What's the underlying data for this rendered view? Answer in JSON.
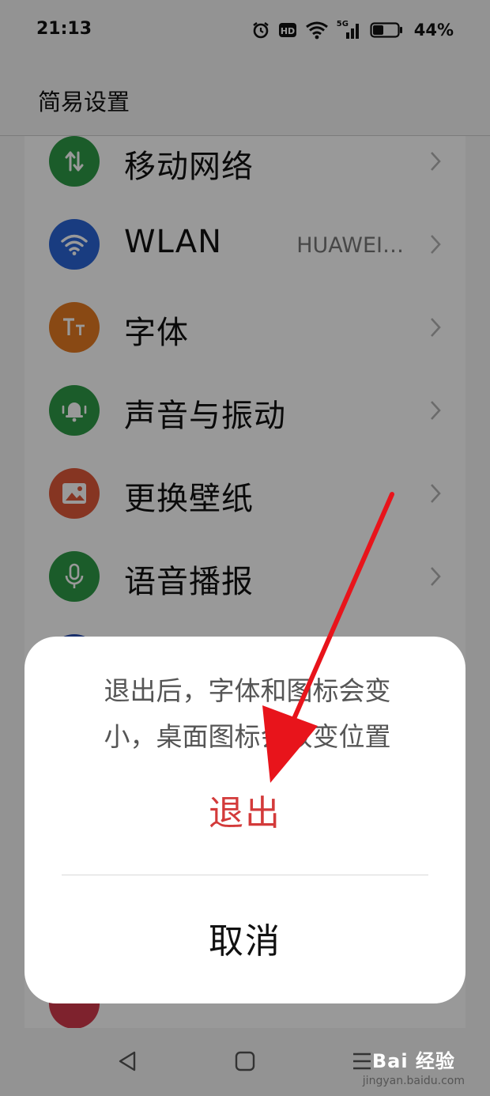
{
  "status_bar": {
    "time": "21:13",
    "network_label": "5G",
    "battery_percent": "44%",
    "battery_level": 0.44,
    "icons": [
      "alarm-icon",
      "hd-icon",
      "wifi-icon",
      "signal-icon",
      "battery-icon"
    ]
  },
  "header": {
    "title": "简易设置"
  },
  "settings": {
    "items": [
      {
        "label": "移动网络",
        "value": "",
        "icon": "mobile-data-icon",
        "color": "#2e9a46"
      },
      {
        "label": "WLAN",
        "value": "HUAWEI…",
        "icon": "wifi-icon",
        "color": "#2a65d6"
      },
      {
        "label": "字体",
        "value": "",
        "icon": "font-icon",
        "color": "#e47a22"
      },
      {
        "label": "声音与振动",
        "value": "",
        "icon": "bell-icon",
        "color": "#2e9a46"
      },
      {
        "label": "更换壁纸",
        "value": "",
        "icon": "wallpaper-icon",
        "color": "#e0593a"
      },
      {
        "label": "语音播报",
        "value": "",
        "icon": "microphone-icon",
        "color": "#2e9a46"
      }
    ]
  },
  "dialog": {
    "message": "退出后，字体和图标会变小，桌面图标会改变位置",
    "exit_label": "退出",
    "cancel_label": "取消",
    "exit_color": "#d33a3a"
  },
  "nav_bar": {
    "icons": [
      "back-icon",
      "home-icon",
      "menu-icon"
    ]
  },
  "watermark": {
    "main": "Bai 经验",
    "sub": "jingyan.baidu.com"
  },
  "annotation": {
    "arrow_color": "#e8141b"
  }
}
